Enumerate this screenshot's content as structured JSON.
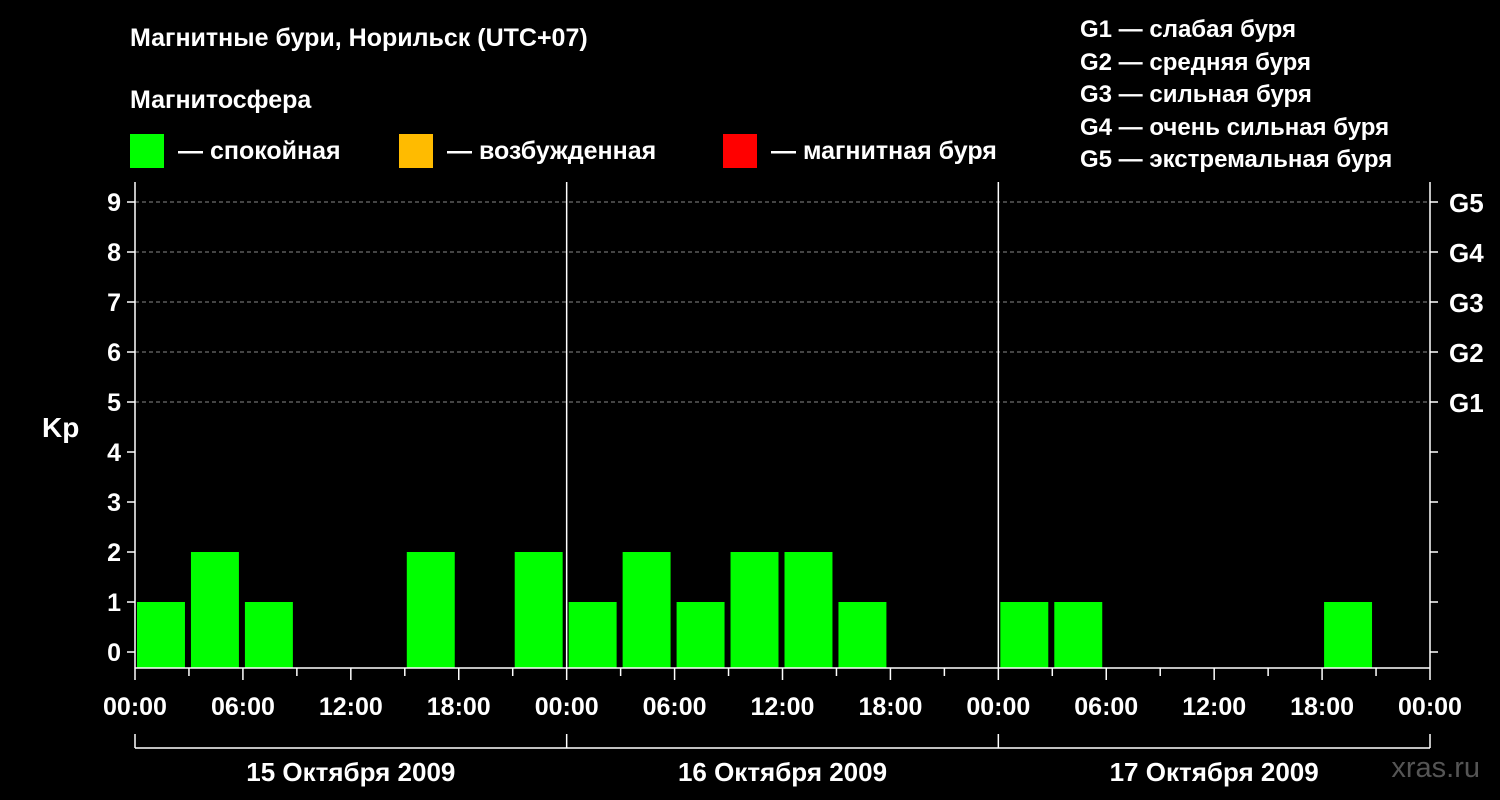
{
  "title": "Магнитные бури, Норильск (UTC+07)",
  "magnetosphere_label": "Магнитосфера",
  "legend": [
    {
      "color": "#00ff00",
      "label": "— спокойная"
    },
    {
      "color": "#ffbb00",
      "label": "— возбужденная"
    },
    {
      "color": "#ff0000",
      "label": "— магнитная буря"
    }
  ],
  "g_legend": [
    "G1 — слабая буря",
    "G2 — средняя буря",
    "G3 — сильная буря",
    "G4 — очень сильная буря",
    "G5 — экстремальная буря"
  ],
  "watermark": "xras.ru",
  "chart_data": {
    "type": "bar",
    "ylabel": "Kp",
    "ylim": [
      0,
      9
    ],
    "y_ticks": [
      "0",
      "1",
      "2",
      "3",
      "4",
      "5",
      "6",
      "7",
      "8",
      "9"
    ],
    "right_ticks": [
      {
        "kp": 5,
        "label": "G1"
      },
      {
        "kp": 6,
        "label": "G2"
      },
      {
        "kp": 7,
        "label": "G3"
      },
      {
        "kp": 8,
        "label": "G4"
      },
      {
        "kp": 9,
        "label": "G5"
      }
    ],
    "x_tick_labels": [
      "00:00",
      "06:00",
      "12:00",
      "18:00",
      "00:00",
      "06:00",
      "12:00",
      "18:00",
      "00:00",
      "06:00",
      "12:00",
      "18:00",
      "00:00"
    ],
    "dates": [
      "15 Октября 2009",
      "16 Октября 2009",
      "17 Октября 2009"
    ],
    "grid": "dashed horizontal at Kp 5-9",
    "colors": {
      "quiet": "#00ff00"
    },
    "bars": [
      {
        "hour": 0,
        "kp": 1
      },
      {
        "hour": 3,
        "kp": 2
      },
      {
        "hour": 6,
        "kp": 1
      },
      {
        "hour": 9,
        "kp": 0
      },
      {
        "hour": 12,
        "kp": 0
      },
      {
        "hour": 15,
        "kp": 2
      },
      {
        "hour": 18,
        "kp": 0
      },
      {
        "hour": 21,
        "kp": 2
      },
      {
        "hour": 24,
        "kp": 1
      },
      {
        "hour": 27,
        "kp": 2
      },
      {
        "hour": 30,
        "kp": 1
      },
      {
        "hour": 33,
        "kp": 2
      },
      {
        "hour": 36,
        "kp": 2
      },
      {
        "hour": 39,
        "kp": 1
      },
      {
        "hour": 42,
        "kp": 0
      },
      {
        "hour": 45,
        "kp": 0
      },
      {
        "hour": 48,
        "kp": 1
      },
      {
        "hour": 51,
        "kp": 1
      },
      {
        "hour": 54,
        "kp": 0
      },
      {
        "hour": 57,
        "kp": 0
      },
      {
        "hour": 60,
        "kp": 0
      },
      {
        "hour": 63,
        "kp": 0
      },
      {
        "hour": 66,
        "kp": 1
      },
      {
        "hour": 69,
        "kp": 0
      }
    ]
  }
}
